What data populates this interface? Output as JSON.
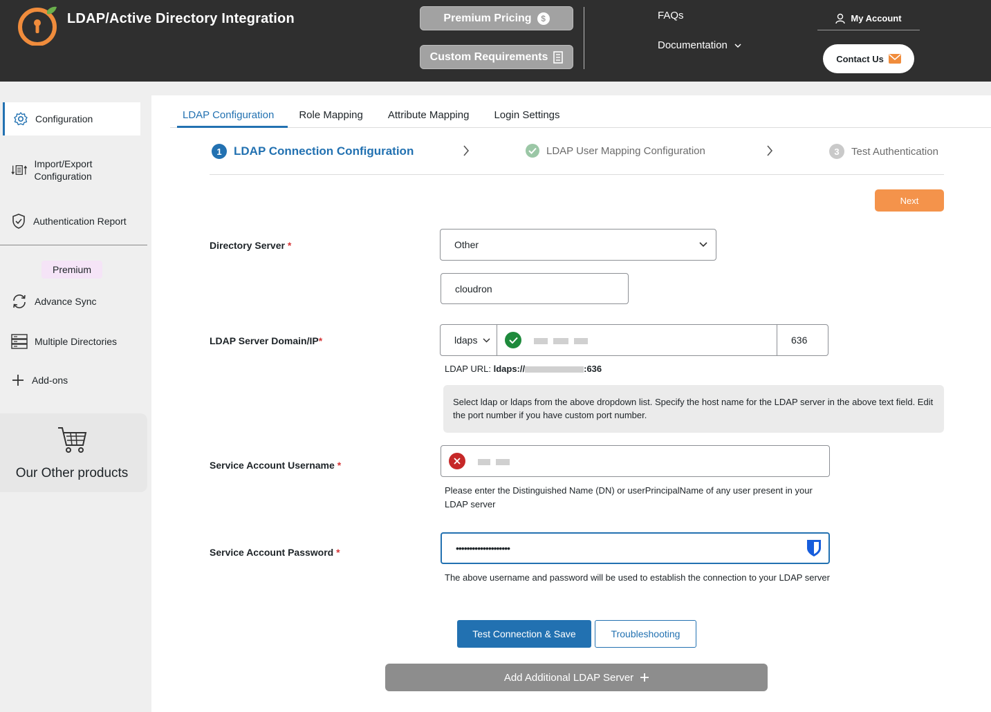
{
  "header": {
    "title": "LDAP/Active Directory Integration",
    "premium_pricing": "Premium Pricing",
    "custom_requirements": "Custom Requirements",
    "faqs": "FAQs",
    "documentation": "Documentation",
    "my_account": "My Account",
    "contact_us": "Contact Us",
    "brand_color": "#f08c3c"
  },
  "sidebar": {
    "items": [
      {
        "label": "Configuration",
        "icon": "gear-icon"
      },
      {
        "label": "Import/Export Configuration",
        "icon": "import-export-icon"
      },
      {
        "label": "Authentication Report",
        "icon": "shield-check-icon"
      },
      {
        "label": "Advance Sync",
        "icon": "sync-icon"
      },
      {
        "label": "Multiple Directories",
        "icon": "directories-icon"
      },
      {
        "label": "Add-ons",
        "icon": "plus-icon"
      }
    ],
    "premium_badge": "Premium",
    "other_products": "Our Other products"
  },
  "tabs": [
    "LDAP Configuration",
    "Role Mapping",
    "Attribute Mapping",
    "Login Settings"
  ],
  "steps": [
    {
      "number": "1",
      "label": "LDAP Connection Configuration"
    },
    {
      "label": "LDAP User Mapping Configuration"
    },
    {
      "number": "3",
      "label": "Test Authentication"
    }
  ],
  "next_button": "Next",
  "form": {
    "directory_server": {
      "label": "Directory Server",
      "value": "Other",
      "other_value": "cloudron"
    },
    "ldap_server": {
      "label": "LDAP Server Domain/IP",
      "protocol": "ldaps",
      "port": "636",
      "url_label": "LDAP URL:",
      "url_prefix": "ldaps://",
      "url_suffix": ":636",
      "help": "Select ldap or ldaps from the above dropdown list. Specify the host name for the LDAP server in the above text field. Edit the port number if you have custom port number."
    },
    "username": {
      "label": "Service Account Username",
      "help": "Please enter the Distinguished Name (DN) or userPrincipalName of any user present in your LDAP server"
    },
    "password": {
      "label": "Service Account Password",
      "value": "••••••••••••••••••••",
      "help": "The above username and password will be used to establish the connection to your LDAP server"
    }
  },
  "buttons": {
    "test_save": "Test Connection & Save",
    "troubleshooting": "Troubleshooting",
    "add_server": "Add Additional LDAP Server"
  },
  "colors": {
    "accent": "#2271b1",
    "next": "#f4934b",
    "success": "#1e8a3c",
    "error": "#c62828"
  }
}
